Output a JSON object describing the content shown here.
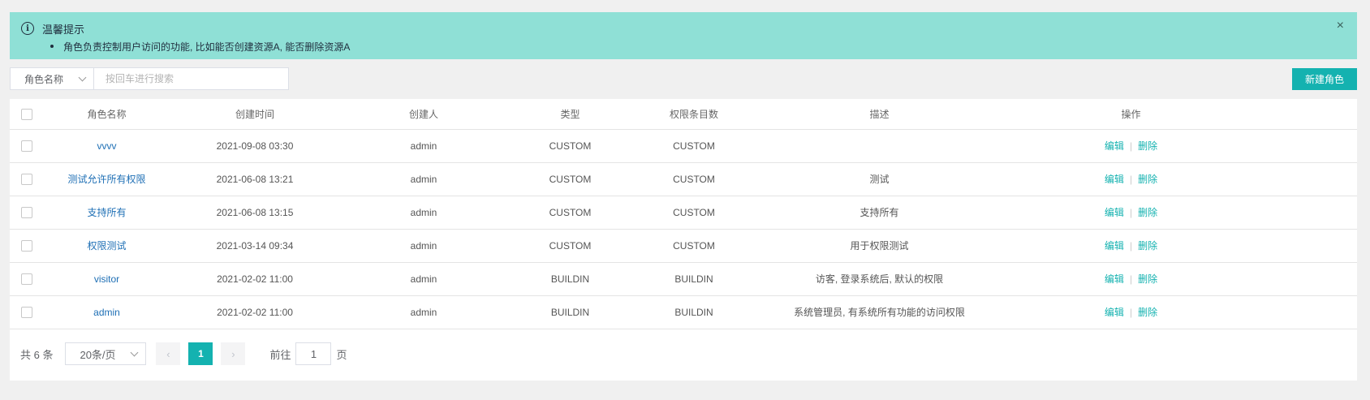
{
  "alert": {
    "title": "温馨提示",
    "items": [
      "角色负责控制用户访问的功能, 比如能否创建资源A, 能否删除资源A"
    ],
    "close": "×"
  },
  "search": {
    "field_select": "角色名称",
    "placeholder": "按回车进行搜索"
  },
  "toolbar": {
    "new_label": "新建角色"
  },
  "table": {
    "headers": [
      "角色名称",
      "创建时间",
      "创建人",
      "类型",
      "权限条目数",
      "描述",
      "操作"
    ],
    "rows": [
      {
        "name": "vvvv",
        "created": "2021-09-08 03:30",
        "creator": "admin",
        "type": "CUSTOM",
        "count": "CUSTOM",
        "desc": ""
      },
      {
        "name": "测试允许所有权限",
        "created": "2021-06-08 13:21",
        "creator": "admin",
        "type": "CUSTOM",
        "count": "CUSTOM",
        "desc": "测试"
      },
      {
        "name": "支持所有",
        "created": "2021-06-08 13:15",
        "creator": "admin",
        "type": "CUSTOM",
        "count": "CUSTOM",
        "desc": "支持所有"
      },
      {
        "name": "权限测试",
        "created": "2021-03-14 09:34",
        "creator": "admin",
        "type": "CUSTOM",
        "count": "CUSTOM",
        "desc": "用于权限测试"
      },
      {
        "name": "visitor",
        "created": "2021-02-02 11:00",
        "creator": "admin",
        "type": "BUILDIN",
        "count": "BUILDIN",
        "desc": "访客, 登录系统后, 默认的权限"
      },
      {
        "name": "admin",
        "created": "2021-02-02 11:00",
        "creator": "admin",
        "type": "BUILDIN",
        "count": "BUILDIN",
        "desc": "系统管理员, 有系统所有功能的访问权限"
      }
    ],
    "edit_label": "编辑",
    "delete_label": "删除",
    "sep": "|"
  },
  "pagination": {
    "total": "共 6 条",
    "page_size": "20条/页",
    "prev": "‹",
    "next": "›",
    "current_page": "1",
    "goto_prefix": "前往",
    "goto_value": "1",
    "goto_suffix": "页"
  },
  "colors": {
    "accent": "#14b2b0",
    "alert_bg": "#8fe0d6",
    "link": "#1e6fb5"
  }
}
